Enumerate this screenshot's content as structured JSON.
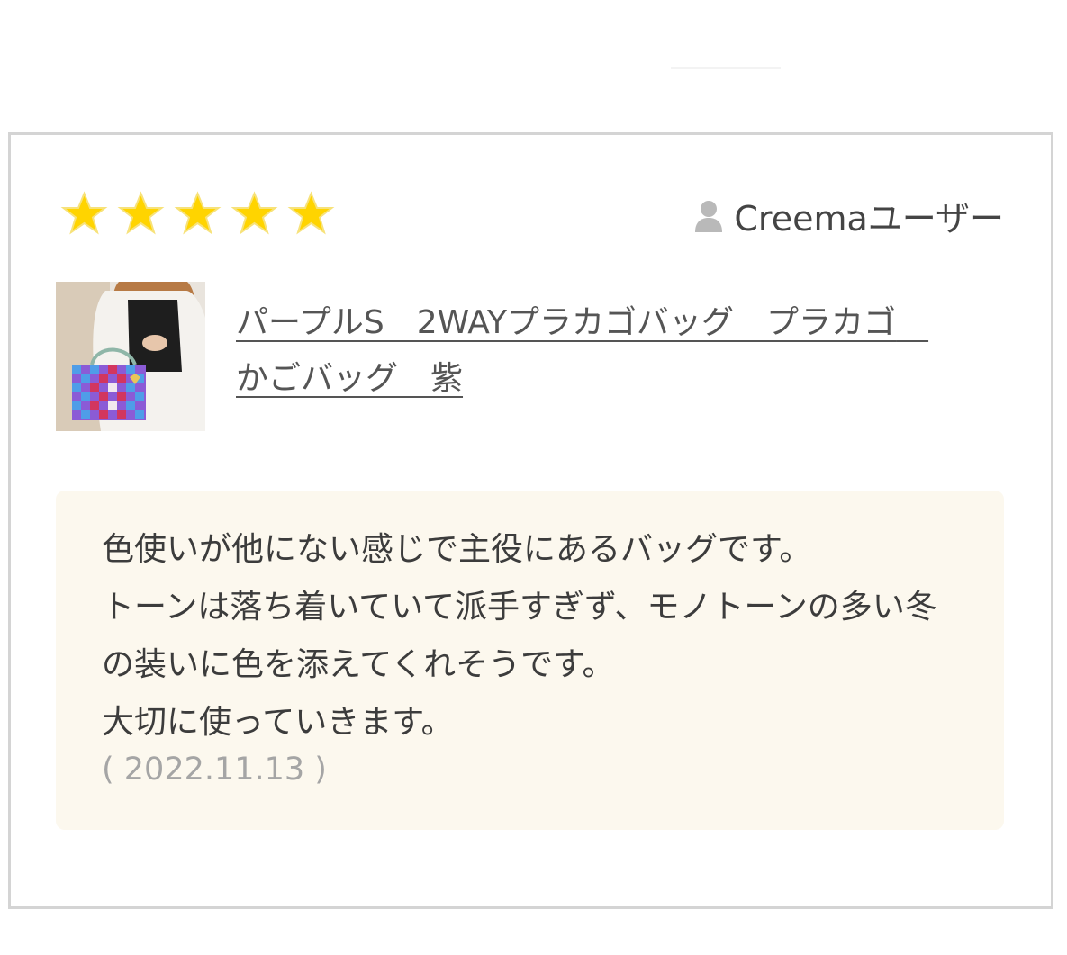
{
  "review": {
    "rating": 5,
    "rating_max": 5,
    "star_color": "#ffd400",
    "reviewer_icon": "user-silhouette-icon",
    "reviewer_name": "Creemaユーザー",
    "product_title": "パープルS　2WAYプラカゴバッグ　プラカゴ　かごバッグ　紫",
    "comment": "色使いが他にない感じで主役にあるバッグです。\nトーンは落ち着いていて派手すぎず、モノトーンの多い冬の装いに色を添えてくれそうです。\n大切に使っていきます。",
    "date": "( 2022.11.13 )"
  },
  "colors": {
    "card_border": "#d4d4d4",
    "comment_background": "#fcf8ee",
    "text": "#444444",
    "date_text": "#a5a5a5"
  }
}
